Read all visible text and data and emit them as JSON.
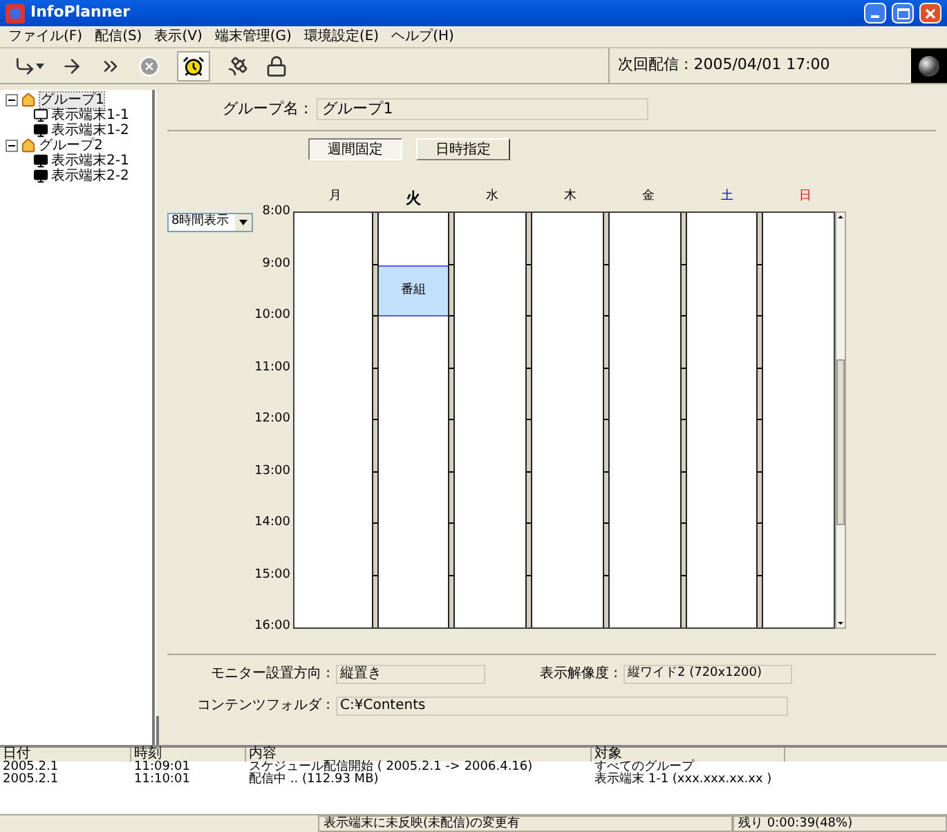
{
  "window": {
    "title": "InfoPlanner"
  },
  "menu": [
    "ファイル(F)",
    "配信(S)",
    "表示(V)",
    "端末管理(G)",
    "環境設定(E)",
    "ヘルプ(H)"
  ],
  "toolbar": {
    "tools": [
      {
        "kind": "send",
        "disabled": false,
        "selected": false
      },
      {
        "kind": "send-one",
        "disabled": false,
        "selected": false
      },
      {
        "kind": "send-all",
        "disabled": false,
        "selected": false
      },
      {
        "kind": "stop",
        "disabled": true,
        "selected": false
      },
      {
        "kind": "schedule",
        "disabled": false,
        "selected": true
      },
      {
        "kind": "satellite",
        "disabled": false,
        "selected": false
      },
      {
        "kind": "lock",
        "disabled": false,
        "selected": false
      }
    ],
    "next_delivery": "次回配信 : 2005/04/01 17:00"
  },
  "tree": [
    {
      "label": "グループ1",
      "expanded": true,
      "selected": true,
      "children": [
        {
          "label": "表示端末1-1",
          "online": false
        },
        {
          "label": "表示端末1-2",
          "online": true
        }
      ]
    },
    {
      "label": "グループ2",
      "expanded": true,
      "selected": false,
      "children": [
        {
          "label": "表示端末2-1",
          "online": true
        },
        {
          "label": "表示端末2-2",
          "online": true
        }
      ]
    }
  ],
  "group_name": {
    "label": "グループ名 :",
    "value": "グループ1"
  },
  "tabs": [
    {
      "label": "週間固定",
      "selected": true
    },
    {
      "label": "日時指定",
      "selected": false
    }
  ],
  "range_select": {
    "value": "8時間表示"
  },
  "times": [
    "8:00",
    "9:00",
    "10:00",
    "11:00",
    "12:00",
    "13:00",
    "14:00",
    "15:00",
    "16:00"
  ],
  "days": [
    {
      "label": "月",
      "color": "#000000",
      "selected": false
    },
    {
      "label": "火",
      "color": "#000000",
      "selected": true,
      "slots": [
        {
          "booked": false
        },
        {
          "booked": true,
          "label": "番組"
        },
        {
          "booked": false
        },
        {
          "booked": false
        },
        {
          "booked": false
        },
        {
          "booked": false
        },
        {
          "booked": false
        },
        {
          "booked": false
        }
      ]
    },
    {
      "label": "水",
      "color": "#000000",
      "selected": false
    },
    {
      "label": "木",
      "color": "#000000",
      "selected": false
    },
    {
      "label": "金",
      "color": "#000000",
      "selected": false
    },
    {
      "label": "土",
      "color": "#0000ff",
      "selected": false
    },
    {
      "label": "日",
      "color": "#ff0000",
      "selected": false
    }
  ],
  "fields": [
    {
      "label": "モニター設置方向 :",
      "value": "縦置き"
    },
    {
      "label": "表示解像度 :",
      "value": "縦ワイド2 (720x1200)"
    },
    {
      "label": "コンテンツフォルダ :",
      "value": "C:¥Contents"
    }
  ],
  "log": {
    "columns": [
      "日付",
      "時刻",
      "内容",
      "対象"
    ],
    "rows": [
      [
        "2005.2.1",
        "11:09:01",
        "スケジュール配信開始 ( 2005.2.1  -> 2006.4.16)",
        "すべてのグループ"
      ],
      [
        "2005.2.1",
        "11:10:01",
        "配信中 .. (112.93 MB)",
        "表示端末 1-1 (xxx.xxx.xx.xx )"
      ]
    ]
  },
  "status_bar": [
    "表示端末に未反映(未配信)の変更有",
    "残り 0:00:39(48%)"
  ]
}
